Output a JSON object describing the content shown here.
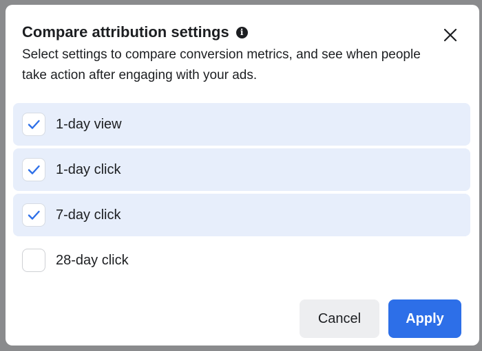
{
  "dialog": {
    "title": "Compare attribution settings",
    "info_icon": "info-icon",
    "subtitle": "Select settings to compare conversion metrics, and see when people take action after engaging with your ads.",
    "close_icon": "close-icon"
  },
  "options": [
    {
      "label": "1-day view",
      "checked": true
    },
    {
      "label": "1-day click",
      "checked": true
    },
    {
      "label": "7-day click",
      "checked": true
    },
    {
      "label": "28-day click",
      "checked": false
    }
  ],
  "footer": {
    "cancel_label": "Cancel",
    "apply_label": "Apply"
  },
  "colors": {
    "accent": "#2d6fe8",
    "selected_row": "#e7eefb",
    "check": "#2d6fe8"
  }
}
